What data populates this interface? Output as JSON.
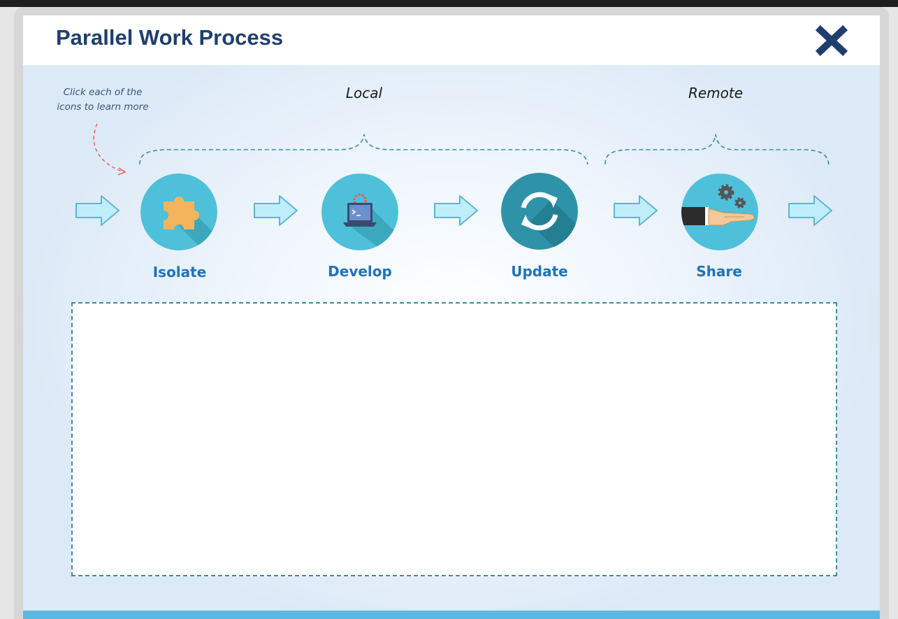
{
  "header": {
    "title": "Parallel Work Process"
  },
  "icons": {
    "close": "close-icon"
  },
  "hint": {
    "line1": "Click each of the",
    "line2": "icons to learn more"
  },
  "groups": {
    "local": "Local",
    "remote": "Remote"
  },
  "steps": [
    {
      "label": "Isolate",
      "icon": "puzzle-piece-icon"
    },
    {
      "label": "Develop",
      "icon": "laptop-terminal-icon"
    },
    {
      "label": "Update",
      "icon": "refresh-icon"
    },
    {
      "label": "Share",
      "icon": "hand-gears-icon"
    }
  ],
  "colors": {
    "title": "#1f3e6e",
    "step_label": "#1f73b9",
    "circle_light": "#4fc0da",
    "circle_dark": "#2e93a8",
    "arrow_fill": "#bfeefa",
    "arrow_stroke": "#5fb6d0",
    "dashed": "#3d8aa9",
    "hint_arrow": "#e8584a",
    "bottom_bar": "#5ab8e3"
  }
}
